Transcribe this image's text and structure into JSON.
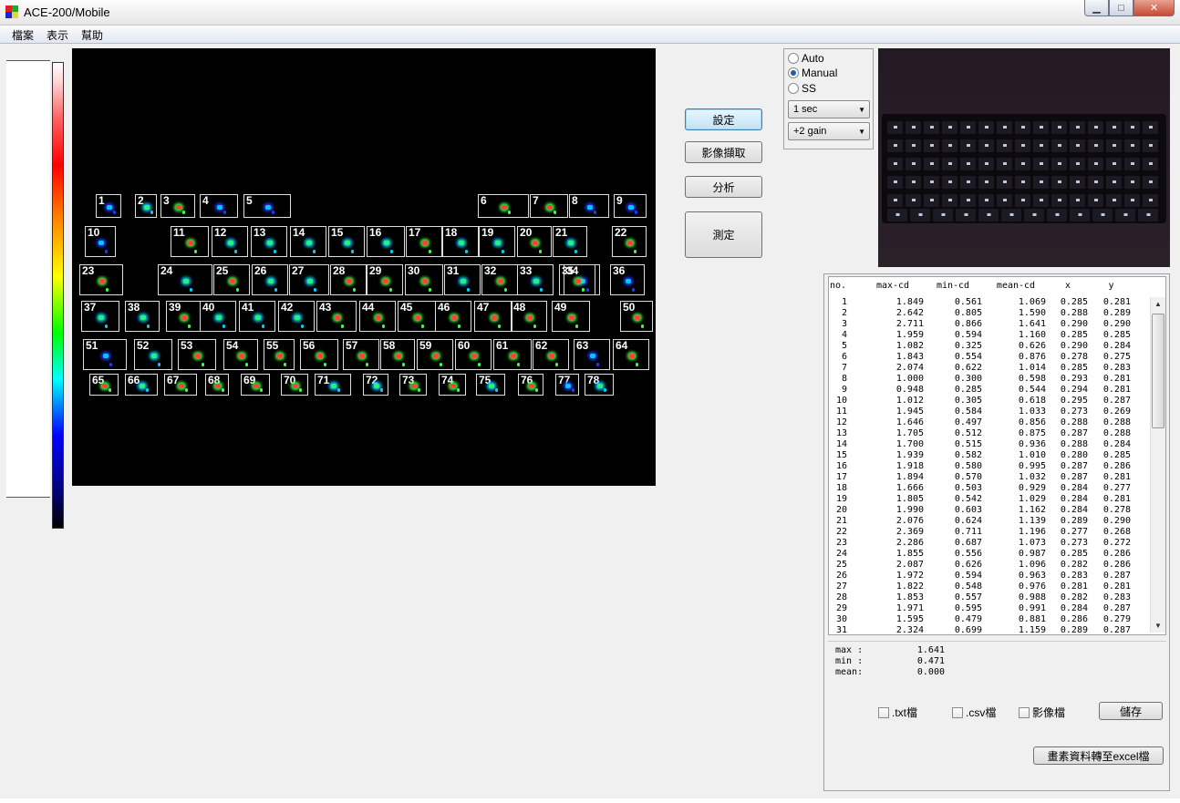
{
  "window": {
    "title": "ACE-200/Mobile",
    "min_glyph": "▁",
    "max_glyph": "□",
    "close_glyph": "✕"
  },
  "menu": [
    "檔案",
    "表示",
    "幫助"
  ],
  "buttons": {
    "settings": "設定",
    "capture": "影像擷取",
    "analyze": "分析",
    "measure": "測定"
  },
  "mode": {
    "options": [
      "Auto",
      "Manual",
      "SS"
    ],
    "selected": "Manual",
    "exposure": "1 sec",
    "gain": "+2 gain"
  },
  "table": {
    "headers": [
      "no.",
      "max-cd",
      "min-cd",
      "mean-cd",
      "x",
      "y"
    ],
    "rows": [
      [
        "1",
        "1.849",
        "0.561",
        "1.069",
        "0.285",
        "0.281"
      ],
      [
        "2",
        "2.642",
        "0.805",
        "1.590",
        "0.288",
        "0.289"
      ],
      [
        "3",
        "2.711",
        "0.866",
        "1.641",
        "0.290",
        "0.290"
      ],
      [
        "4",
        "1.959",
        "0.594",
        "1.160",
        "0.285",
        "0.285"
      ],
      [
        "5",
        "1.082",
        "0.325",
        "0.626",
        "0.290",
        "0.284"
      ],
      [
        "6",
        "1.843",
        "0.554",
        "0.876",
        "0.278",
        "0.275"
      ],
      [
        "7",
        "2.074",
        "0.622",
        "1.014",
        "0.285",
        "0.283"
      ],
      [
        "8",
        "1.000",
        "0.300",
        "0.598",
        "0.293",
        "0.281"
      ],
      [
        "9",
        "0.948",
        "0.285",
        "0.544",
        "0.294",
        "0.281"
      ],
      [
        "10",
        "1.012",
        "0.305",
        "0.618",
        "0.295",
        "0.287"
      ],
      [
        "11",
        "1.945",
        "0.584",
        "1.033",
        "0.273",
        "0.269"
      ],
      [
        "12",
        "1.646",
        "0.497",
        "0.856",
        "0.288",
        "0.288"
      ],
      [
        "13",
        "1.705",
        "0.512",
        "0.875",
        "0.287",
        "0.288"
      ],
      [
        "14",
        "1.700",
        "0.515",
        "0.936",
        "0.288",
        "0.284"
      ],
      [
        "15",
        "1.939",
        "0.582",
        "1.010",
        "0.280",
        "0.285"
      ],
      [
        "16",
        "1.918",
        "0.580",
        "0.995",
        "0.287",
        "0.286"
      ],
      [
        "17",
        "1.894",
        "0.570",
        "1.032",
        "0.287",
        "0.281"
      ],
      [
        "18",
        "1.666",
        "0.503",
        "0.929",
        "0.284",
        "0.277"
      ],
      [
        "19",
        "1.805",
        "0.542",
        "1.029",
        "0.284",
        "0.281"
      ],
      [
        "20",
        "1.990",
        "0.603",
        "1.162",
        "0.284",
        "0.278"
      ],
      [
        "21",
        "2.076",
        "0.624",
        "1.139",
        "0.289",
        "0.290"
      ],
      [
        "22",
        "2.369",
        "0.711",
        "1.196",
        "0.277",
        "0.268"
      ],
      [
        "23",
        "2.286",
        "0.687",
        "1.073",
        "0.273",
        "0.272"
      ],
      [
        "24",
        "1.855",
        "0.556",
        "0.987",
        "0.285",
        "0.286"
      ],
      [
        "25",
        "2.087",
        "0.626",
        "1.096",
        "0.282",
        "0.286"
      ],
      [
        "26",
        "1.972",
        "0.594",
        "0.963",
        "0.283",
        "0.287"
      ],
      [
        "27",
        "1.822",
        "0.548",
        "0.976",
        "0.281",
        "0.281"
      ],
      [
        "28",
        "1.853",
        "0.557",
        "0.988",
        "0.282",
        "0.283"
      ],
      [
        "29",
        "1.971",
        "0.595",
        "0.991",
        "0.284",
        "0.287"
      ],
      [
        "30",
        "1.595",
        "0.479",
        "0.881",
        "0.286",
        "0.279"
      ],
      [
        "31",
        "2.324",
        "0.699",
        "1.159",
        "0.289",
        "0.287"
      ]
    ]
  },
  "stats": [
    {
      "label": "max :",
      "value": "1.641"
    },
    {
      "label": "min :",
      "value": "0.471"
    },
    {
      "label": "mean:",
      "value": "0.000"
    }
  ],
  "save_options": {
    "txt": ".txt檔",
    "csv": ".csv檔",
    "image": "影像檔"
  },
  "save_button": "儲存",
  "export_button": "畫素資料轉至excel檔",
  "zones": [
    {
      "n": "1",
      "lvl": 1
    },
    {
      "n": "2",
      "lvl": 2
    },
    {
      "n": "3",
      "lvl": 3
    },
    {
      "n": "4",
      "lvl": 1
    },
    {
      "n": "5",
      "lvl": 1
    },
    {
      "n": "6",
      "lvl": 3
    },
    {
      "n": "7",
      "lvl": 3
    },
    {
      "n": "8",
      "lvl": 1
    },
    {
      "n": "9",
      "lvl": 1
    },
    {
      "n": "10",
      "lvl": 1
    },
    {
      "n": "11",
      "lvl": 3
    },
    {
      "n": "12",
      "lvl": 2
    },
    {
      "n": "13",
      "lvl": 2
    },
    {
      "n": "14",
      "lvl": 2
    },
    {
      "n": "15",
      "lvl": 2
    },
    {
      "n": "16",
      "lvl": 2
    },
    {
      "n": "17",
      "lvl": 3
    },
    {
      "n": "18",
      "lvl": 2
    },
    {
      "n": "19",
      "lvl": 2
    },
    {
      "n": "20",
      "lvl": 3
    },
    {
      "n": "21",
      "lvl": 2
    },
    {
      "n": "22",
      "lvl": 3
    },
    {
      "n": "23",
      "lvl": 3
    },
    {
      "n": "24",
      "lvl": 2
    },
    {
      "n": "25",
      "lvl": 3
    },
    {
      "n": "26",
      "lvl": 2
    },
    {
      "n": "27",
      "lvl": 2
    },
    {
      "n": "28",
      "lvl": 3
    },
    {
      "n": "29",
      "lvl": 3
    },
    {
      "n": "30",
      "lvl": 3
    },
    {
      "n": "31",
      "lvl": 2
    },
    {
      "n": "32",
      "lvl": 3
    },
    {
      "n": "33",
      "lvl": 2
    },
    {
      "n": "34",
      "lvl": 1
    },
    {
      "n": "35",
      "lvl": 3
    },
    {
      "n": "36",
      "lvl": 1
    },
    {
      "n": "37",
      "lvl": 2
    },
    {
      "n": "38",
      "lvl": 2
    },
    {
      "n": "39",
      "lvl": 3
    },
    {
      "n": "40",
      "lvl": 2
    },
    {
      "n": "41",
      "lvl": 2
    },
    {
      "n": "42",
      "lvl": 2
    },
    {
      "n": "43",
      "lvl": 3
    },
    {
      "n": "44",
      "lvl": 3
    },
    {
      "n": "45",
      "lvl": 3
    },
    {
      "n": "46",
      "lvl": 3
    },
    {
      "n": "47",
      "lvl": 3
    },
    {
      "n": "48",
      "lvl": 3
    },
    {
      "n": "49",
      "lvl": 3
    },
    {
      "n": "50",
      "lvl": 3
    },
    {
      "n": "51",
      "lvl": 1
    },
    {
      "n": "52",
      "lvl": 2
    },
    {
      "n": "53",
      "lvl": 3
    },
    {
      "n": "54",
      "lvl": 3
    },
    {
      "n": "55",
      "lvl": 3
    },
    {
      "n": "56",
      "lvl": 3
    },
    {
      "n": "57",
      "lvl": 3
    },
    {
      "n": "58",
      "lvl": 3
    },
    {
      "n": "59",
      "lvl": 3
    },
    {
      "n": "60",
      "lvl": 3
    },
    {
      "n": "61",
      "lvl": 3
    },
    {
      "n": "62",
      "lvl": 3
    },
    {
      "n": "63",
      "lvl": 1
    },
    {
      "n": "64",
      "lvl": 3
    },
    {
      "n": "65",
      "lvl": 3
    },
    {
      "n": "66",
      "lvl": 2
    },
    {
      "n": "67",
      "lvl": 3
    },
    {
      "n": "68",
      "lvl": 3
    },
    {
      "n": "69",
      "lvl": 3
    },
    {
      "n": "70",
      "lvl": 3
    },
    {
      "n": "71",
      "lvl": 2
    },
    {
      "n": "72",
      "lvl": 2
    },
    {
      "n": "73",
      "lvl": 3
    },
    {
      "n": "74",
      "lvl": 3
    },
    {
      "n": "75",
      "lvl": 2
    },
    {
      "n": "76",
      "lvl": 3
    },
    {
      "n": "77",
      "lvl": 1
    },
    {
      "n": "78",
      "lvl": 2
    }
  ]
}
